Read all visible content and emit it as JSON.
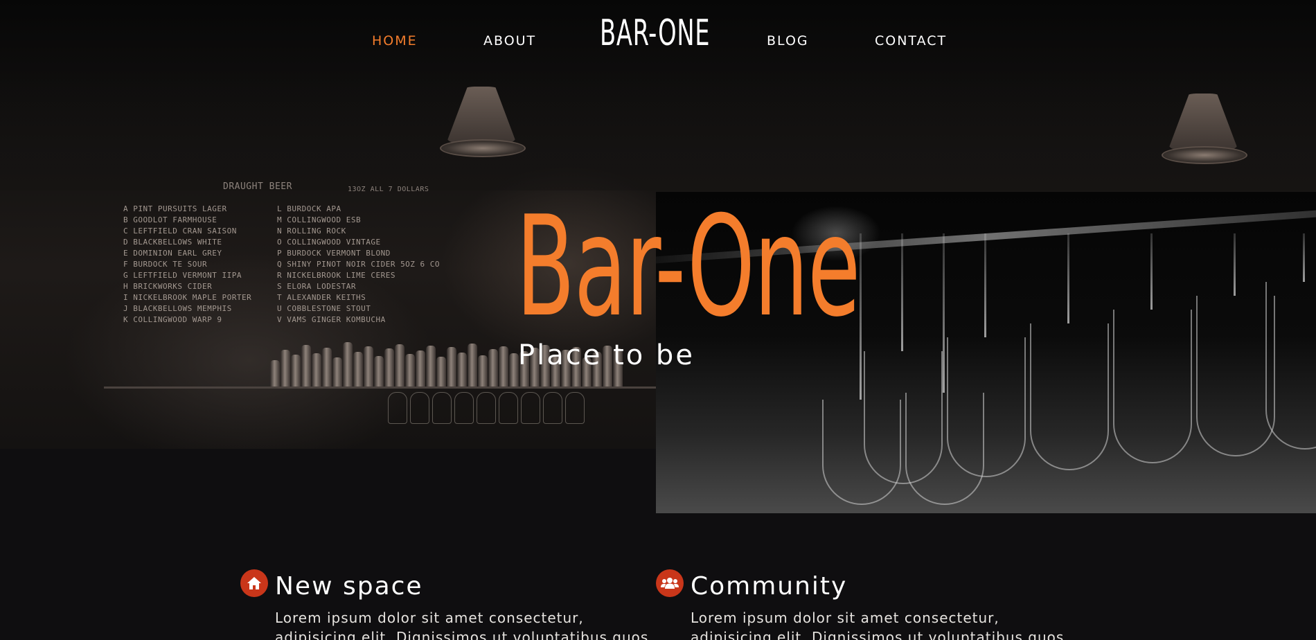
{
  "nav": {
    "links": [
      "HOME",
      "ABOUT",
      "BLOG",
      "CONTACT"
    ],
    "active": "HOME",
    "logo": "BAR-ONE"
  },
  "hero": {
    "title": "Bar-One",
    "subtitle": "Place to be",
    "board": {
      "title": "DRAUGHT BEER",
      "sub": "13OZ ALL 7 DOLLARS",
      "left": [
        "A PINT PURSUITS LAGER",
        "B GOODLOT FARMHOUSE",
        "C LEFTFIELD CRAN SAISON",
        "D BLACKBELLOWS WHITE",
        "E DOMINION EARL GREY",
        "F BURDOCK TE SOUR",
        "G LEFTFIELD VERMONT IIPA",
        "H BRICKWORKS CIDER",
        "I NICKELBROOK MAPLE PORTER",
        "J BLACKBELLOWS MEMPHIS",
        "K COLLINGWOOD WARP 9"
      ],
      "right": [
        "L BURDOCK APA",
        "M COLLINGWOOD ESB",
        "N ROLLING ROCK",
        "O COLLINGWOOD VINTAGE",
        "P BURDOCK VERMONT BLOND",
        "Q SHINY PINOT NOIR CIDER 5OZ 6 CO",
        "R NICKELBROOK LIME CERES",
        "S ELORA LODESTAR",
        "T ALEXANDER KEITHS",
        "U COBBLESTONE STOUT",
        "V VAMS GINGER KOMBUCHA"
      ]
    }
  },
  "features": [
    {
      "icon": "home-icon",
      "title": "New space",
      "text": "Lorem ipsum dolor sit amet consectetur, adipisicing elit. Dignissimos ut voluptatibus quos maiores"
    },
    {
      "icon": "users-icon",
      "title": "Community",
      "text": "Lorem ipsum dolor sit amet consectetur, adipisicing elit. Dignissimos ut voluptatibus quos maiores"
    }
  ],
  "colors": {
    "accent": "#f47d2c",
    "icon_bg": "#c9361a",
    "background": "#0f0e10"
  }
}
